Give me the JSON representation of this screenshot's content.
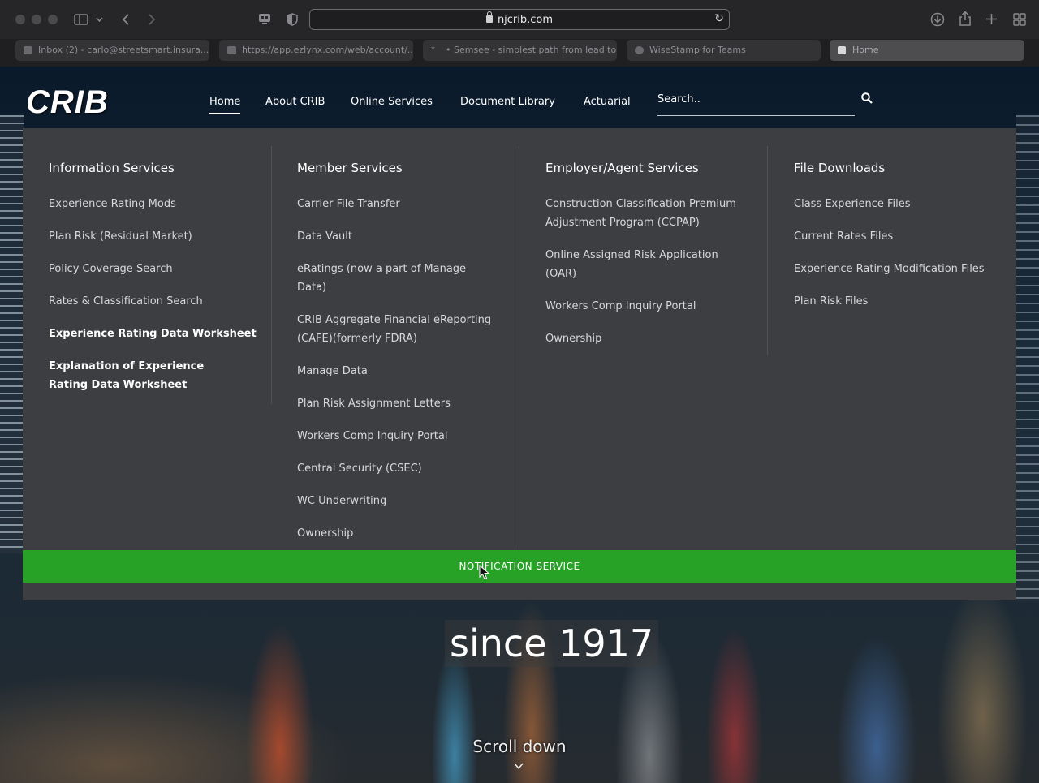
{
  "browser": {
    "url": "njcrib.com",
    "tabs": [
      {
        "label": "Inbox (2) - carlo@streetsmart.insura...",
        "active": false
      },
      {
        "label": "https://app.ezlynx.com/web/account/...",
        "active": false
      },
      {
        "label": "• Semsee - simplest path from lead to...",
        "active": false
      },
      {
        "label": "WiseStamp for Teams",
        "active": false
      },
      {
        "label": "Home",
        "active": true
      }
    ]
  },
  "site": {
    "logo": "CRIB",
    "nav": {
      "items": [
        "Home",
        "About CRIB",
        "Online Services",
        "Document Library",
        "Actuarial"
      ],
      "active": "Home",
      "search_placeholder": "Search.."
    }
  },
  "mega_menu": {
    "columns": [
      {
        "heading": "Information Services",
        "links": [
          {
            "text": "Experience Rating Mods",
            "bold": false
          },
          {
            "text": "Plan Risk (Residual Market)",
            "bold": false
          },
          {
            "text": "Policy Coverage Search",
            "bold": false
          },
          {
            "text": "Rates & Classification Search",
            "bold": false
          },
          {
            "text": "Experience Rating Data Worksheet",
            "bold": true
          },
          {
            "text": "Explanation of Experience Rating Data Worksheet",
            "bold": true
          }
        ]
      },
      {
        "heading": "Member Services",
        "links": [
          {
            "text": "Carrier File Transfer",
            "bold": false
          },
          {
            "text": "Data Vault",
            "bold": false
          },
          {
            "text": "eRatings (now a part of Manage Data)",
            "bold": false
          },
          {
            "text": "CRIB Aggregate Financial eReporting (CAFE)(formerly FDRA)",
            "bold": false
          },
          {
            "text": "Manage Data",
            "bold": false
          },
          {
            "text": "Plan Risk Assignment Letters",
            "bold": false
          },
          {
            "text": "Workers Comp Inquiry Portal",
            "bold": false
          },
          {
            "text": "Central Security (CSEC)",
            "bold": false
          },
          {
            "text": "WC Underwriting",
            "bold": false
          },
          {
            "text": "Ownership",
            "bold": false
          }
        ]
      },
      {
        "heading": "Employer/Agent Services",
        "links": [
          {
            "text": "Construction Classification Premium Adjustment Program (CCPAP)",
            "bold": false
          },
          {
            "text": "Online Assigned Risk Application (OAR)",
            "bold": false
          },
          {
            "text": "Workers Comp Inquiry Portal",
            "bold": false
          },
          {
            "text": "Ownership",
            "bold": false
          }
        ]
      },
      {
        "heading": "File Downloads",
        "links": [
          {
            "text": "Class Experience Files",
            "bold": false
          },
          {
            "text": "Current Rates Files",
            "bold": false
          },
          {
            "text": "Experience Rating Modification Files",
            "bold": false
          },
          {
            "text": "Plan Risk Files",
            "bold": false
          }
        ]
      }
    ],
    "notification_button": "NOTIFICATION SERVICE"
  },
  "hero": {
    "tagline": "since 1917",
    "scroll_label": "Scroll down"
  },
  "colors": {
    "menu_bg": "#3c3e41",
    "notification_green": "#27a126"
  }
}
